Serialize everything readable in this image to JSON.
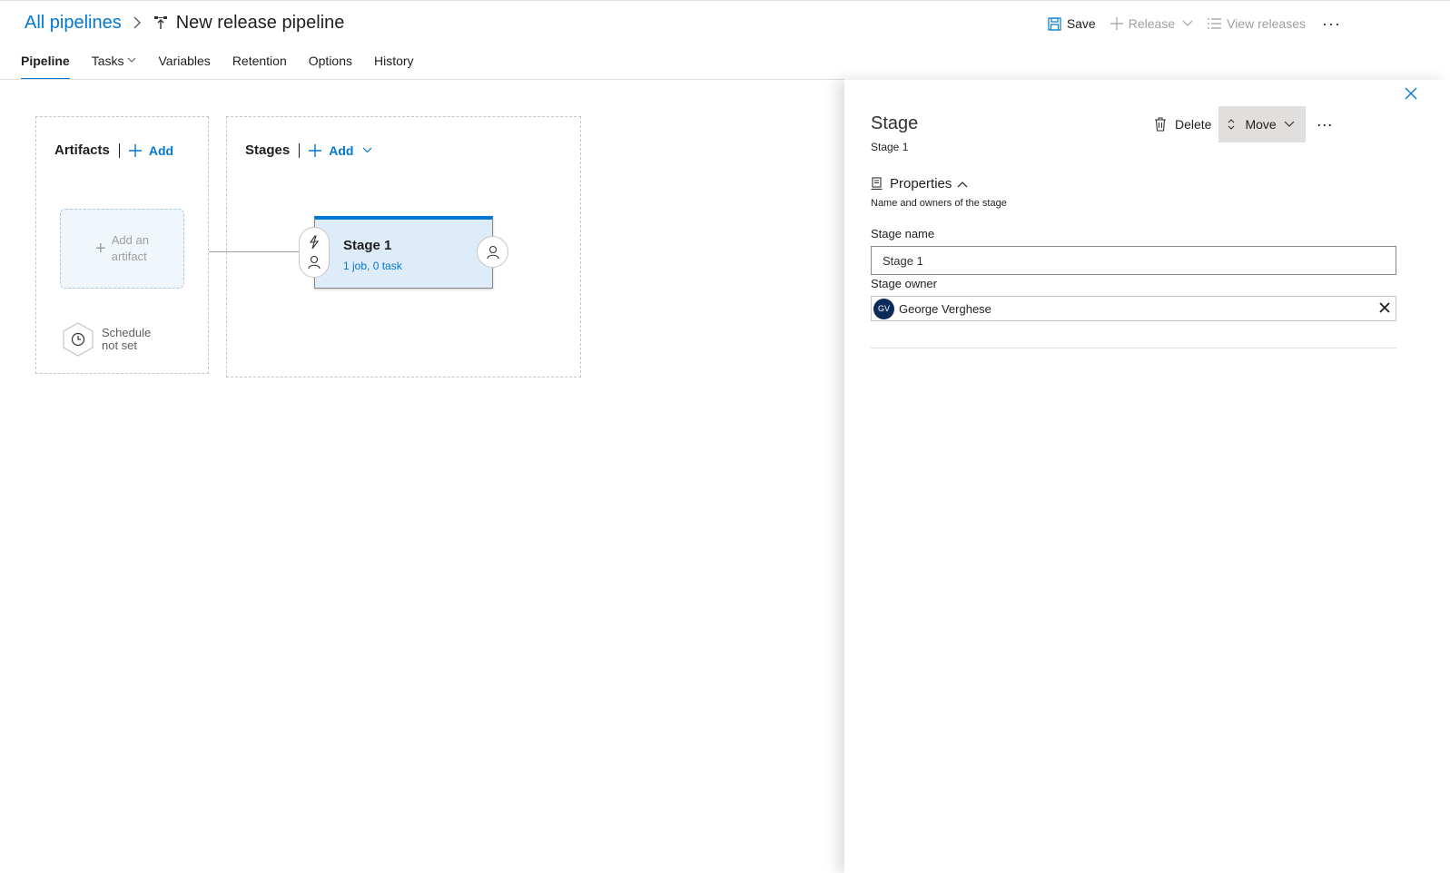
{
  "header": {
    "breadcrumb_root": "All pipelines",
    "pipeline_title": "New release pipeline"
  },
  "toolbar": {
    "save_label": "Save",
    "release_label": "Release",
    "view_releases_label": "View releases",
    "more_label": "···"
  },
  "tabs": [
    {
      "label": "Pipeline",
      "active": true
    },
    {
      "label": "Tasks",
      "has_dropdown": true
    },
    {
      "label": "Variables"
    },
    {
      "label": "Retention"
    },
    {
      "label": "Options"
    },
    {
      "label": "History"
    }
  ],
  "artifacts": {
    "title": "Artifacts",
    "add_label": "Add",
    "add_artifact_line1": "Add an",
    "add_artifact_line2": "artifact",
    "schedule_line1": "Schedule",
    "schedule_line2": "not set"
  },
  "stages": {
    "title": "Stages",
    "add_label": "Add",
    "stage_card": {
      "name": "Stage 1",
      "summary": "1 job, 0 task"
    }
  },
  "panel": {
    "title": "Stage",
    "subtitle": "Stage 1",
    "delete_label": "Delete",
    "move_label": "Move",
    "more_label": "···",
    "properties_label": "Properties",
    "properties_desc": "Name and owners of the stage",
    "stage_name_label": "Stage name",
    "stage_name_value": "Stage 1",
    "stage_owner_label": "Stage owner",
    "owner_initials": "GV",
    "owner_name": "George Verghese"
  },
  "colors": {
    "accent": "#0078d4",
    "stage_card_bg": "#deecf9",
    "avatar_bg": "#0d2a5c"
  }
}
